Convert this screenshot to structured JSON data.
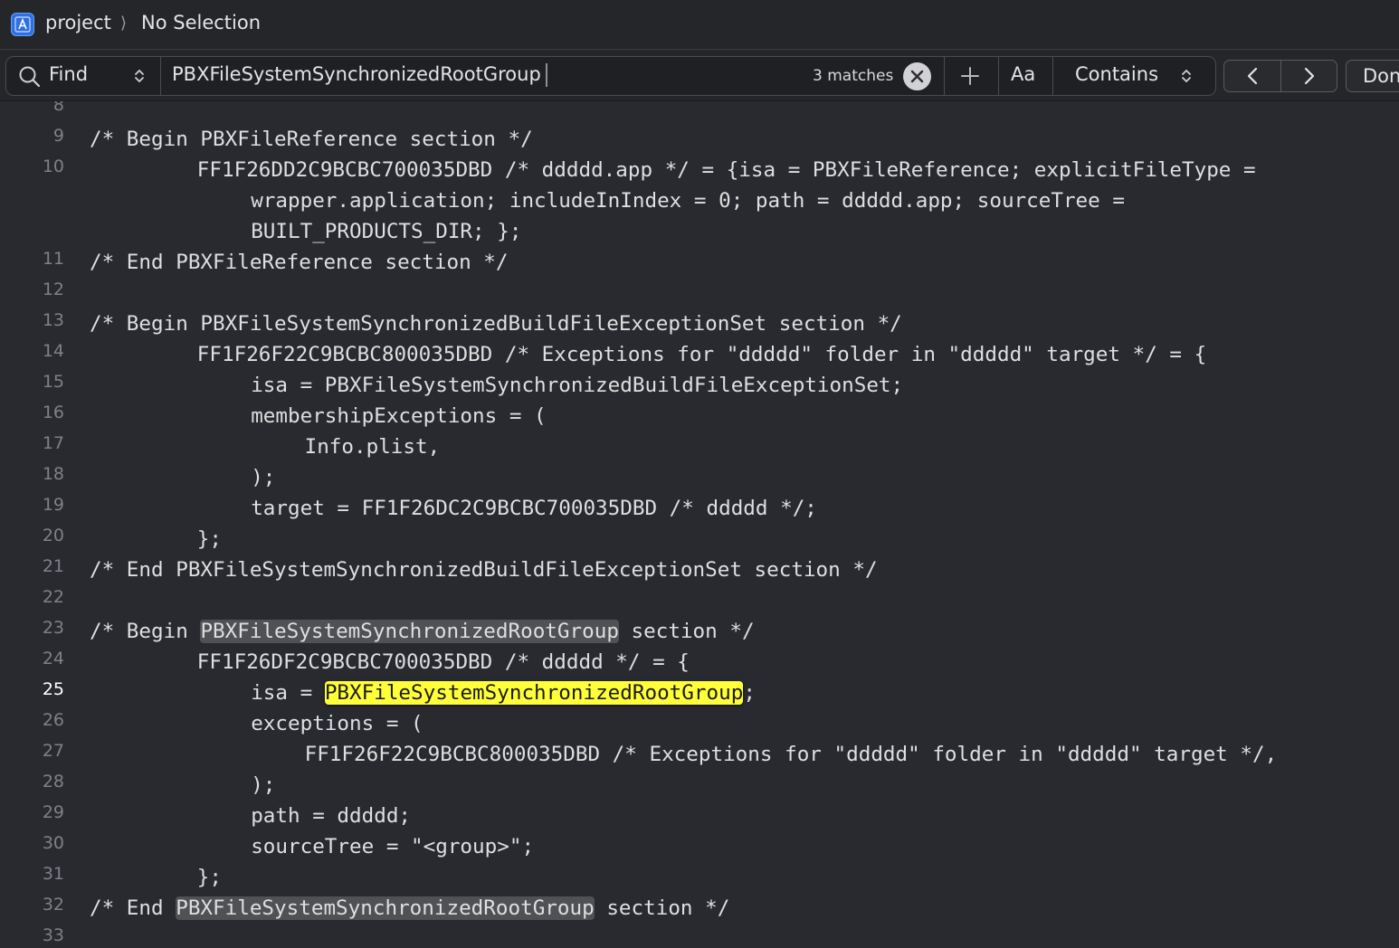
{
  "jumpbar": {
    "project_label": "project",
    "chevron": "⟩",
    "selection_label": "No Selection",
    "project_icon": "xcode-project-icon"
  },
  "findbar": {
    "mode_label": "Find",
    "query": "PBXFileSystemSynchronizedRootGroup",
    "match_count": "3 matches",
    "case_label": "Aa",
    "match_style": "Contains",
    "done_label": "Done"
  },
  "editor": {
    "lines": [
      {
        "num": "8",
        "parts": [
          {
            "t": ""
          }
        ]
      },
      {
        "num": "9",
        "parts": [
          {
            "t": "/* Begin PBXFileReference section */"
          }
        ]
      },
      {
        "num": "10",
        "parts": [
          {
            "t": "FF1F26DD2C9BCBC700035DBD /* ddddd.app */ = {isa = PBXFileReference; explicitFileType ="
          }
        ]
      },
      {
        "num": "",
        "parts": [
          {
            "t": "wrapper.application; includeInIndex = 0; path = ddddd.app; sourceTree ="
          }
        ]
      },
      {
        "num": "",
        "parts": [
          {
            "t": "BUILT_PRODUCTS_DIR; };"
          }
        ]
      },
      {
        "num": "11",
        "parts": [
          {
            "t": "/* End PBXFileReference section */"
          }
        ]
      },
      {
        "num": "12",
        "parts": [
          {
            "t": ""
          }
        ]
      },
      {
        "num": "13",
        "parts": [
          {
            "t": "/* Begin PBXFileSystemSynchronizedBuildFileExceptionSet section */"
          }
        ]
      },
      {
        "num": "14",
        "parts": [
          {
            "t": "FF1F26F22C9BCBC800035DBD /* Exceptions for \"ddddd\" folder in \"ddddd\" target */ = {"
          }
        ]
      },
      {
        "num": "15",
        "parts": [
          {
            "t": "isa = PBXFileSystemSynchronizedBuildFileExceptionSet;"
          }
        ]
      },
      {
        "num": "16",
        "parts": [
          {
            "t": "membershipExceptions = ("
          }
        ]
      },
      {
        "num": "17",
        "parts": [
          {
            "t": "Info.plist,"
          }
        ]
      },
      {
        "num": "18",
        "parts": [
          {
            "t": ");"
          }
        ]
      },
      {
        "num": "19",
        "parts": [
          {
            "t": "target = FF1F26DC2C9BCBC700035DBD /* ddddd */;"
          }
        ]
      },
      {
        "num": "20",
        "parts": [
          {
            "t": "};"
          }
        ]
      },
      {
        "num": "21",
        "parts": [
          {
            "t": "/* End PBXFileSystemSynchronizedBuildFileExceptionSet section */"
          }
        ]
      },
      {
        "num": "22",
        "parts": [
          {
            "t": ""
          }
        ]
      },
      {
        "num": "23",
        "parts": [
          {
            "t": "/* Begin "
          },
          {
            "t": "PBXFileSystemSynchronizedRootGroup",
            "hl": "match"
          },
          {
            "t": " section */"
          }
        ]
      },
      {
        "num": "24",
        "parts": [
          {
            "t": "FF1F26DF2C9BCBC700035DBD /* ddddd */ = {"
          }
        ]
      },
      {
        "num": "25",
        "current": true,
        "parts": [
          {
            "t": "isa = "
          },
          {
            "t": "PBXFileSystemSynchronizedRootGroup",
            "hl": "current-match"
          },
          {
            "t": ";"
          }
        ]
      },
      {
        "num": "26",
        "parts": [
          {
            "t": "exceptions = ("
          }
        ]
      },
      {
        "num": "27",
        "parts": [
          {
            "t": "FF1F26F22C9BCBC800035DBD /* Exceptions for \"ddddd\" folder in \"ddddd\" target */,"
          }
        ]
      },
      {
        "num": "28",
        "parts": [
          {
            "t": ");"
          }
        ]
      },
      {
        "num": "29",
        "parts": [
          {
            "t": "path = ddddd;"
          }
        ]
      },
      {
        "num": "30",
        "parts": [
          {
            "t": "sourceTree = \"<group>\";"
          }
        ]
      },
      {
        "num": "31",
        "parts": [
          {
            "t": "};"
          }
        ]
      },
      {
        "num": "32",
        "parts": [
          {
            "t": "/* End "
          },
          {
            "t": "PBXFileSystemSynchronizedRootGroup",
            "hl": "match"
          },
          {
            "t": " section */"
          }
        ]
      },
      {
        "num": "33",
        "parts": [
          {
            "t": ""
          }
        ]
      }
    ]
  },
  "colors": {
    "background": "#292a30",
    "match_highlight": "#505155",
    "current_match_highlight": "#ffff3a"
  }
}
